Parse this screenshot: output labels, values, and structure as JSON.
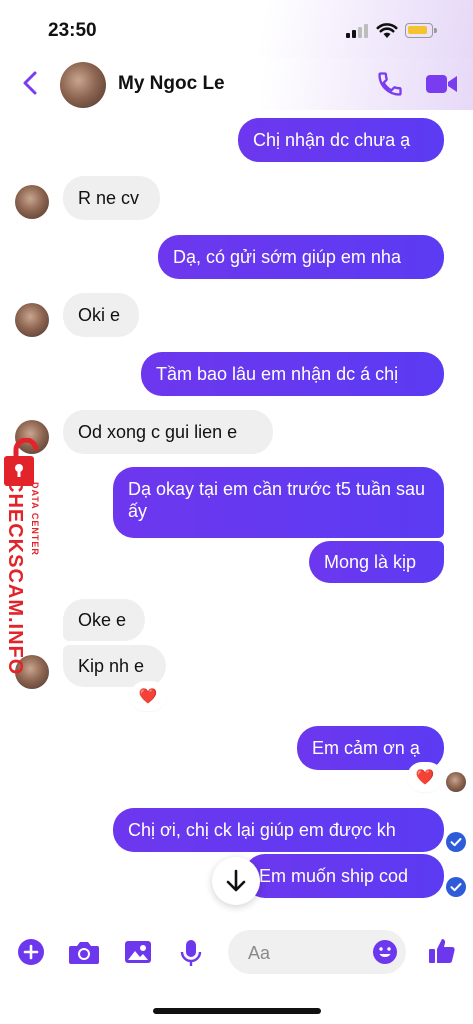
{
  "status": {
    "time": "23:50"
  },
  "header": {
    "contact_name": "My Ngoc Le"
  },
  "messages": [
    {
      "side": "out",
      "text": "Chị nhận dc chưa ạ"
    },
    {
      "side": "in",
      "text": "R ne cv"
    },
    {
      "side": "out",
      "text": "Dạ, có gửi sớm giúp em nha"
    },
    {
      "side": "in",
      "text": "Oki e"
    },
    {
      "side": "out",
      "text": "Tầm bao lâu em nhận dc á chị"
    },
    {
      "side": "in",
      "text": "Od xong c gui lien e"
    },
    {
      "side": "out",
      "text": "Dạ okay tại em cần trước t5 tuần sau ấy"
    },
    {
      "side": "out",
      "text": "Mong là kịp"
    },
    {
      "side": "in",
      "text": "Oke e"
    },
    {
      "side": "in",
      "text": "Kip nh e",
      "reaction": "❤️"
    },
    {
      "side": "out",
      "text": "Em cảm ơn ạ",
      "reaction": "❤️"
    },
    {
      "side": "out",
      "text": "Chị ơi, chị ck lại giúp em được kh"
    },
    {
      "side": "out",
      "text": "Em muốn ship cod"
    }
  ],
  "watermark": {
    "main": "CHECKSCAM.INFO",
    "sub": "DATA CENTER"
  },
  "composer": {
    "placeholder": "Aa"
  },
  "colors": {
    "accent": "#6d37ee",
    "incoming": "#efefef",
    "watermark": "#e2242a"
  },
  "icons": {
    "status": [
      "signal-icon",
      "wifi-icon",
      "battery-icon"
    ],
    "header": [
      "back-chevron-icon",
      "phone-icon",
      "video-camera-icon"
    ],
    "composer": [
      "plus-icon",
      "camera-icon",
      "image-icon",
      "microphone-icon",
      "emoji-icon",
      "thumbs-up-icon"
    ]
  }
}
